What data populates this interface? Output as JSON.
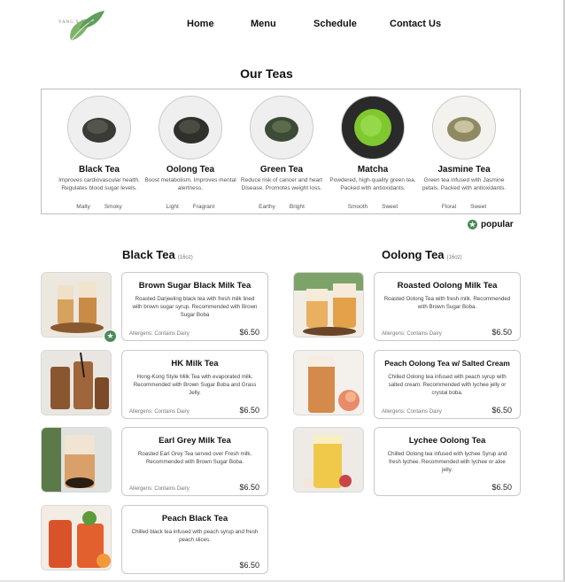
{
  "brand": {
    "logo_text": "YANG'S TEA"
  },
  "nav": [
    "Home",
    "Menu",
    "Schedule",
    "Contact Us"
  ],
  "our_teas": {
    "title": "Our Teas",
    "teas": [
      {
        "name": "Black Tea",
        "description": "Improves cardiovascular health. Regulates blood sugar levels.",
        "tags": [
          "Malty",
          "Smoky"
        ]
      },
      {
        "name": "Oolong Tea",
        "description": "Boost metabolism. Improves mental alertness.",
        "tags": [
          "Light",
          "Fragrant"
        ]
      },
      {
        "name": "Green Tea",
        "description": "Reduce risk of cancer and heart Disease. Promotes weight loss.",
        "tags": [
          "Earthy",
          "Bright"
        ]
      },
      {
        "name": "Matcha",
        "description": "Powdered, high-quality green tea. Packed with antioxidants.",
        "tags": [
          "Smooth",
          "Sweet"
        ]
      },
      {
        "name": "Jasmine Tea",
        "description": "Green tea infused with Jasmine petals. Packed with antioxidants.",
        "tags": [
          "Floral",
          "Sweet"
        ]
      }
    ]
  },
  "popular_legend": {
    "label": "popular",
    "icon": "star-icon"
  },
  "black_tea": {
    "title": "Black Tea",
    "size": "(16oz)",
    "items": [
      {
        "name": "Brown Sugar Black Milk Tea",
        "description": "Roasted Darjeeling black tea with fresh milk lined with brown sugar syrup. Recommended with Brown Sugar Boba",
        "allergens": "Allergens: Contains Dairy",
        "price": "$6.50",
        "popular": true
      },
      {
        "name": "HK Milk Tea",
        "description": "Hong-Kong Style Milk Tea with evaporated milk. Recommended with Brown Sugar Boba and Grass Jelly.",
        "allergens": "Allergens: Contains Dairy",
        "price": "$6.50"
      },
      {
        "name": "Earl Grey Milk Tea",
        "description": "Roasted Earl Grey Tea served over Fresh milk. Recommended with Brown Sugar Boba.",
        "allergens": "Allergens: Contains Dairy",
        "price": "$6.50"
      },
      {
        "name": "Peach Black Tea",
        "description": "Chilled black tea infused with peach syrup and fresh peach slices.",
        "allergens": "",
        "price": "$6.50"
      }
    ]
  },
  "oolong_tea": {
    "title": "Oolong Tea",
    "size": "(16oz)",
    "items": [
      {
        "name": "Roasted Oolong Milk Tea",
        "description": "Roasted Oolong Tea with fresh milk. Recommended with Brown Sugar Boba.",
        "allergens": "Allergens: Contains Dairy",
        "price": "$6.50"
      },
      {
        "name": "Peach Oolong Tea w/ Salted Cream",
        "description": "Chilled Oolong tea infused with peach syrup with salted cream. Recommended with lychee jelly or crystal boba.",
        "allergens": "Allergens: Contains Dairy",
        "price": "$6.50"
      },
      {
        "name": "Lychee Oolong Tea",
        "description": "Chilled Oolong tea infused with lychee Syrup and fresh lychee. Recommended with lychee or aloe jelly.",
        "allergens": "",
        "price": "$6.50"
      }
    ]
  },
  "colors": {
    "accent_green": "#4b8a5a",
    "border": "#c9c9c9"
  }
}
